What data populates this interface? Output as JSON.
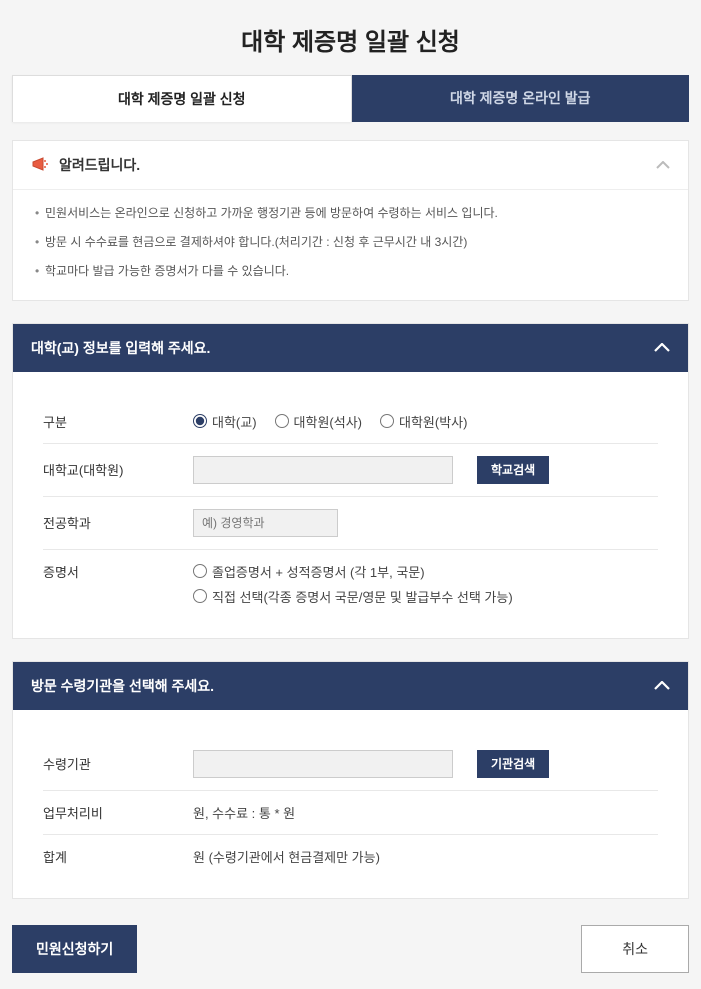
{
  "page": {
    "title": "대학 제증명 일괄 신청"
  },
  "tabs": {
    "batch": "대학 제증명 일괄 신청",
    "online": "대학 제증명 온라인 발급"
  },
  "notice": {
    "title": "알려드립니다.",
    "items": [
      "민원서비스는 온라인으로 신청하고 가까운 행정기관 등에 방문하여 수령하는 서비스 입니다.",
      "방문 시 수수료를 현금으로 결제하셔야 합니다.(처리기간 : 신청 후 근무시간 내 3시간)",
      "학교마다 발급 가능한 증명서가 다를 수 있습니다."
    ]
  },
  "section_univ": {
    "title": "대학(교) 정보를 입력해 주세요.",
    "labels": {
      "gubun": "구분",
      "school": "대학교(대학원)",
      "major": "전공학과",
      "cert": "증명서"
    },
    "radios": {
      "univ": "대학(교)",
      "master": "대학원(석사)",
      "doctor": "대학원(박사)"
    },
    "school_search_btn": "학교검색",
    "major_placeholder": "예) 경영학과",
    "cert_options": {
      "combo": "졸업증명서 + 성적증명서 (각 1부, 국문)",
      "direct": "직접 선택(각종 증명서 국문/영문 및 발급부수 선택 가능)"
    }
  },
  "section_pickup": {
    "title": "방문 수령기관을 선택해 주세요.",
    "labels": {
      "org": "수령기관",
      "fee": "업무처리비",
      "total": "합계"
    },
    "org_search_btn": "기관검색",
    "fee_value": "원, 수수료 : 통 * 원",
    "total_value": "원 (수령기관에서 현금결제만 가능)"
  },
  "actions": {
    "submit": "민원신청하기",
    "cancel": "취소"
  }
}
